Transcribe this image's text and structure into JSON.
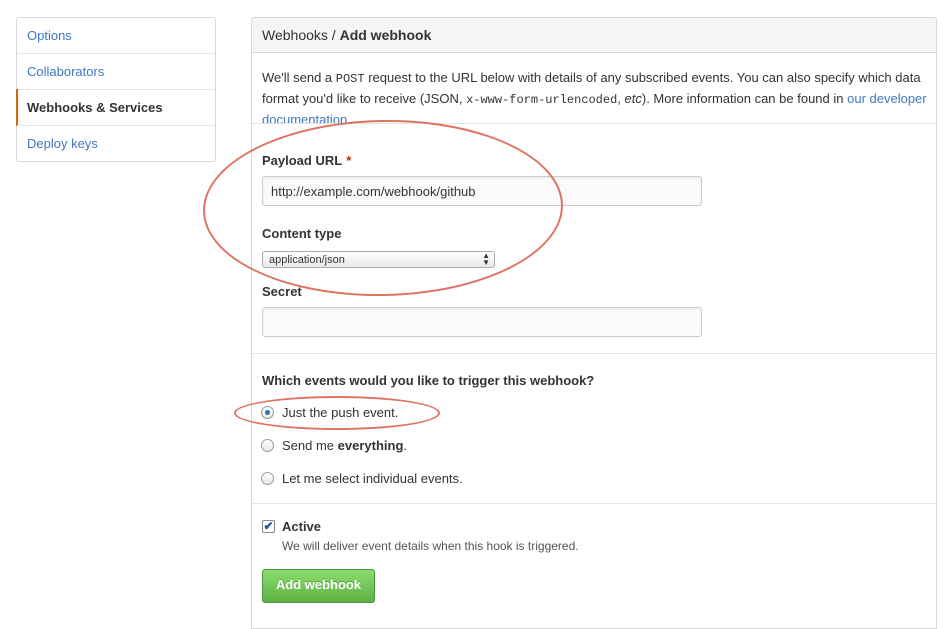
{
  "sidebar": {
    "items": [
      {
        "label": "Options",
        "selected": false
      },
      {
        "label": "Collaborators",
        "selected": false
      },
      {
        "label": "Webhooks & Services",
        "selected": true
      },
      {
        "label": "Deploy keys",
        "selected": false
      }
    ]
  },
  "header": {
    "breadcrumb_parent": "Webhooks",
    "separator": " / ",
    "title": "Add webhook"
  },
  "intro": {
    "part1": "We'll send a ",
    "method": "POST",
    "part2": " request to the URL below with details of any subscribed events. You can also specify which data format you'd like to receive (JSON, ",
    "encoding": "x-www-form-urlencoded",
    "part3": ", ",
    "etc": "etc",
    "part4": "). More information can be found in ",
    "link_text": "our developer documentation",
    "part5": "."
  },
  "form": {
    "payload_url_label": "Payload URL",
    "required_mark": "*",
    "payload_url_value": "http://example.com/webhook/github",
    "content_type_label": "Content type",
    "content_type_value": "application/json",
    "secret_label": "Secret",
    "secret_value": ""
  },
  "events": {
    "question": "Which events would you like to trigger this webhook?",
    "options": [
      {
        "label": "Just the push event.",
        "selected": true
      },
      {
        "label_pre": "Send me ",
        "label_bold": "everything",
        "label_post": ".",
        "selected": false
      },
      {
        "label": "Let me select individual events.",
        "selected": false
      }
    ]
  },
  "active": {
    "checked": true,
    "label": "Active",
    "note": "We will deliver event details when this hook is triggered."
  },
  "submit_label": "Add webhook",
  "colors": {
    "link": "#4078c0",
    "button": "#60b044",
    "annotation": "#e07262",
    "selected_indicator": "#d26911"
  }
}
